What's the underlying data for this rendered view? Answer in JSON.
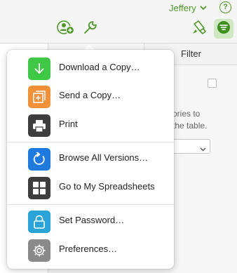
{
  "header": {
    "user_name": "Jeffery",
    "help_label": "?",
    "colors": {
      "accent": "#4d9a28",
      "organize_bg": "#cfe8c2"
    }
  },
  "toolbar": {
    "icons": [
      "collaborate-icon",
      "wrench-icon",
      "paintbrush-icon",
      "organize-icon"
    ]
  },
  "background": {
    "filter_tab": "Filter",
    "hint_line1": "ories to",
    "hint_line2": "the table."
  },
  "menu": {
    "groups": [
      [
        {
          "label": "Download a Copy…",
          "icon": "download-icon",
          "color": "#3fc746"
        },
        {
          "label": "Send a Copy…",
          "icon": "send-copy-icon",
          "color": "#f0913a"
        },
        {
          "label": "Print",
          "icon": "print-icon",
          "color": "#3d3d3d"
        }
      ],
      [
        {
          "label": "Browse All Versions…",
          "icon": "versions-icon",
          "color": "#1f7ae0"
        },
        {
          "label": "Go to My Spreadsheets",
          "icon": "spreadsheets-icon",
          "color": "#3d3d3d"
        }
      ],
      [
        {
          "label": "Set Password…",
          "icon": "lock-icon",
          "color": "#2aa3d8"
        },
        {
          "label": "Preferences…",
          "icon": "gear-icon",
          "color": "#8a8a8a"
        }
      ]
    ]
  }
}
